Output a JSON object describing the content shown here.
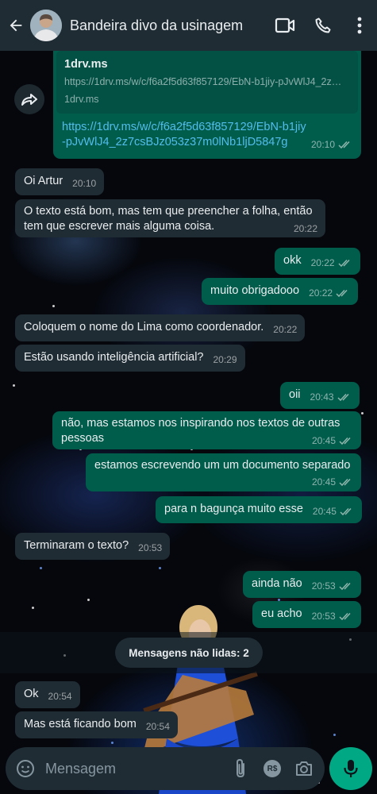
{
  "header": {
    "title": "Bandeira divo da usinagem"
  },
  "link_message": {
    "preview_title": "1drv.ms",
    "preview_url": "https://1drv.ms/w/c/f6a2f5d63f857129/EbN-b1jiy-pJvWlJ4_2z…",
    "preview_domain": "1drv.ms",
    "link_text_line1": "https://1drv.ms/w/c/f6a2f5d63f857129/EbN-b1jiy",
    "link_text_line2": "-pJvWlJ4_2z7csBJz053z37m0lNb1ljD5847g",
    "time": "20:10"
  },
  "messages": [
    {
      "text": "Oi Artur",
      "time": "20:10"
    },
    {
      "line1": "O texto está bom, mas tem que preencher a folha, então",
      "line2": "tem que escrever mais alguma coisa.",
      "time": "20:22"
    },
    {
      "text": "okk",
      "time": "20:22"
    },
    {
      "text": "muito obrigadooo",
      "time": "20:22"
    },
    {
      "text": "Coloquem o nome do Lima como coordenador.",
      "time": "20:22"
    },
    {
      "text": "Estão usando inteligência artificial?",
      "time": "20:29"
    },
    {
      "text": "oii",
      "time": "20:43"
    },
    {
      "line1": "não, mas estamos nos inspirando nos textos de outras",
      "line2": "pessoas",
      "time": "20:45"
    },
    {
      "line1": "estamos escrevendo um um documento separado",
      "time": "20:45"
    },
    {
      "text": "para n bagunça muito esse",
      "time": "20:45"
    },
    {
      "text": "Terminaram o texto?",
      "time": "20:53"
    },
    {
      "text": "ainda não",
      "time": "20:53"
    },
    {
      "text": "eu acho",
      "time": "20:53"
    },
    {
      "text": "Ok",
      "time": "20:54"
    },
    {
      "text": "Mas está ficando bom",
      "time": "20:54"
    }
  ],
  "unread_divider": "Mensagens não lidas: 2",
  "input": {
    "placeholder": "Mensagem",
    "payment_icon_label": "R$"
  },
  "colors": {
    "header_bg": "#1f2c34",
    "incoming_bubble": "#202c33",
    "outgoing_bubble": "#005c4b",
    "accent_green": "#00a884",
    "link_blue": "#53bdeb"
  },
  "icons": [
    "back-arrow-icon",
    "video-call-icon",
    "phone-icon",
    "more-vert-icon",
    "forward-icon",
    "double-check-icon",
    "emoji-icon",
    "attach-icon",
    "payment-icon",
    "camera-icon",
    "mic-icon"
  ]
}
